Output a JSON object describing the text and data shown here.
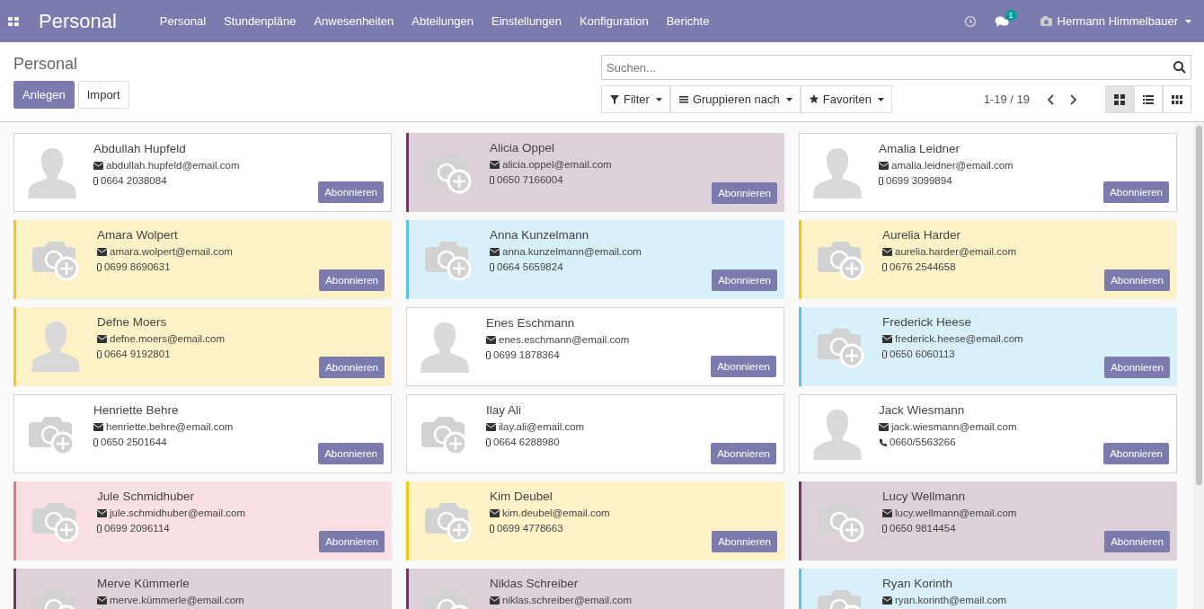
{
  "navbar": {
    "app_title": "Personal",
    "menu": [
      "Personal",
      "Stundenpläne",
      "Anwesenheiten",
      "Abteilungen",
      "Einstellungen",
      "Konfiguration",
      "Berichte"
    ],
    "message_count": "1",
    "user": "Hermann Himmelbauer"
  },
  "control_panel": {
    "breadcrumb": "Personal",
    "buttons": [
      "Anlegen",
      "Import"
    ],
    "search": {
      "placeholder": "Suchen..."
    },
    "filters": [
      {
        "kind": "filter",
        "label": "Filter"
      },
      {
        "kind": "group",
        "label": "Gruppieren nach"
      },
      {
        "kind": "favorites",
        "label": "Favoriten"
      }
    ],
    "pager": "1-19 / 19",
    "views": [
      {
        "kind": "kanban",
        "selected": true
      },
      {
        "kind": "list",
        "selected": false
      },
      {
        "kind": "grid",
        "selected": false
      }
    ]
  },
  "cards": [
    {
      "kind": "avatar",
      "name": "Abdullah Hupfeld",
      "email": "abdullah.hupfeld@email.com",
      "phone": {
        "kind": "mobile",
        "number": "0664 2038084"
      },
      "button": "Abonnieren"
    },
    {
      "kind": "camera",
      "name": "Alicia Oppel",
      "email": "alicia.oppel@email.com",
      "phone": {
        "kind": "mobile",
        "number": "0650 7166004"
      },
      "color": "#6c3a61",
      "button": "Abonnieren"
    },
    {
      "kind": "avatar",
      "name": "Amalia Leidner",
      "email": "amalia.leidner@email.com",
      "phone": {
        "kind": "mobile",
        "number": "0699 3099894"
      },
      "button": "Abonnieren"
    },
    {
      "kind": "camera",
      "name": "Amara Wolpert",
      "email": "amara.wolpert@email.com",
      "phone": {
        "kind": "mobile",
        "number": "0699 8690631"
      },
      "color": "#f5c518",
      "button": "Abonnieren"
    },
    {
      "kind": "camera",
      "name": "Anna Kunzelmann",
      "email": "anna.kunzelmann@email.com",
      "phone": {
        "kind": "mobile",
        "number": "0664 5659824"
      },
      "color": "#5bc0eb",
      "button": "Abonnieren"
    },
    {
      "kind": "camera",
      "name": "Aurelia Harder",
      "email": "aurelia.harder@email.com",
      "phone": {
        "kind": "mobile",
        "number": "0676 2544658"
      },
      "color": "#f5c518",
      "button": "Abonnieren"
    },
    {
      "kind": "avatar",
      "name": "Defne Moers",
      "email": "defne.moers@email.com",
      "phone": {
        "kind": "mobile",
        "number": "0664 9192801"
      },
      "color": "#f5c518",
      "button": "Abonnieren"
    },
    {
      "kind": "avatar",
      "name": "Enes Eschmann",
      "email": "enes.eschmann@email.com",
      "phone": {
        "kind": "mobile",
        "number": "0699 1878364"
      },
      "button": "Abonnieren"
    },
    {
      "kind": "camera",
      "name": "Frederick Heese",
      "email": "frederick.heese@email.com",
      "phone": {
        "kind": "mobile",
        "number": "0650 6060113"
      },
      "color": "#5bc0eb",
      "button": "Abonnieren"
    },
    {
      "kind": "camera",
      "name": "Henriette Behre",
      "email": "henriette.behre@email.com",
      "phone": {
        "kind": "mobile",
        "number": "0650 2501644"
      },
      "button": "Abonnieren"
    },
    {
      "kind": "camera",
      "name": "Ilay Ali",
      "email": "ilay.ali@email.com",
      "phone": {
        "kind": "mobile",
        "number": "0664 6288980"
      },
      "button": "Abonnieren"
    },
    {
      "kind": "avatar",
      "name": "Jack Wiesmann",
      "email": "jack.wiesmann@email.com",
      "phone": {
        "kind": "phone",
        "number": "0660/5563266"
      },
      "button": "Abonnieren"
    },
    {
      "kind": "camera",
      "name": "Jule Schmidhuber",
      "email": "jule.schmidhuber@email.com",
      "phone": {
        "kind": "mobile",
        "number": "0699 2096114"
      },
      "color": "#e07a85",
      "button": "Abonnieren"
    },
    {
      "kind": "camera",
      "name": "Kim Deubel",
      "email": "kim.deubel@email.com",
      "phone": {
        "kind": "mobile",
        "number": "0699 4778663"
      },
      "color": "#f5c518",
      "button": "Abonnieren"
    },
    {
      "kind": "camera",
      "name": "Lucy Wellmann",
      "email": "lucy.wellmann@email.com",
      "phone": {
        "kind": "mobile",
        "number": "0650 9814454"
      },
      "color": "#6c3a61",
      "button": "Abonnieren"
    },
    {
      "kind": "camera",
      "name": "Merve Kümmerle",
      "email": "merve.kümmerle@email.com",
      "color": "#6c3a61"
    },
    {
      "kind": "camera",
      "name": "Niklas Schreiber",
      "email": "niklas.schreiber@email.com",
      "color": "#6c3a61"
    },
    {
      "kind": "camera",
      "name": "Ryan Korinth",
      "email": "ryan.korinth@email.com",
      "color": "#5bc0eb"
    }
  ]
}
